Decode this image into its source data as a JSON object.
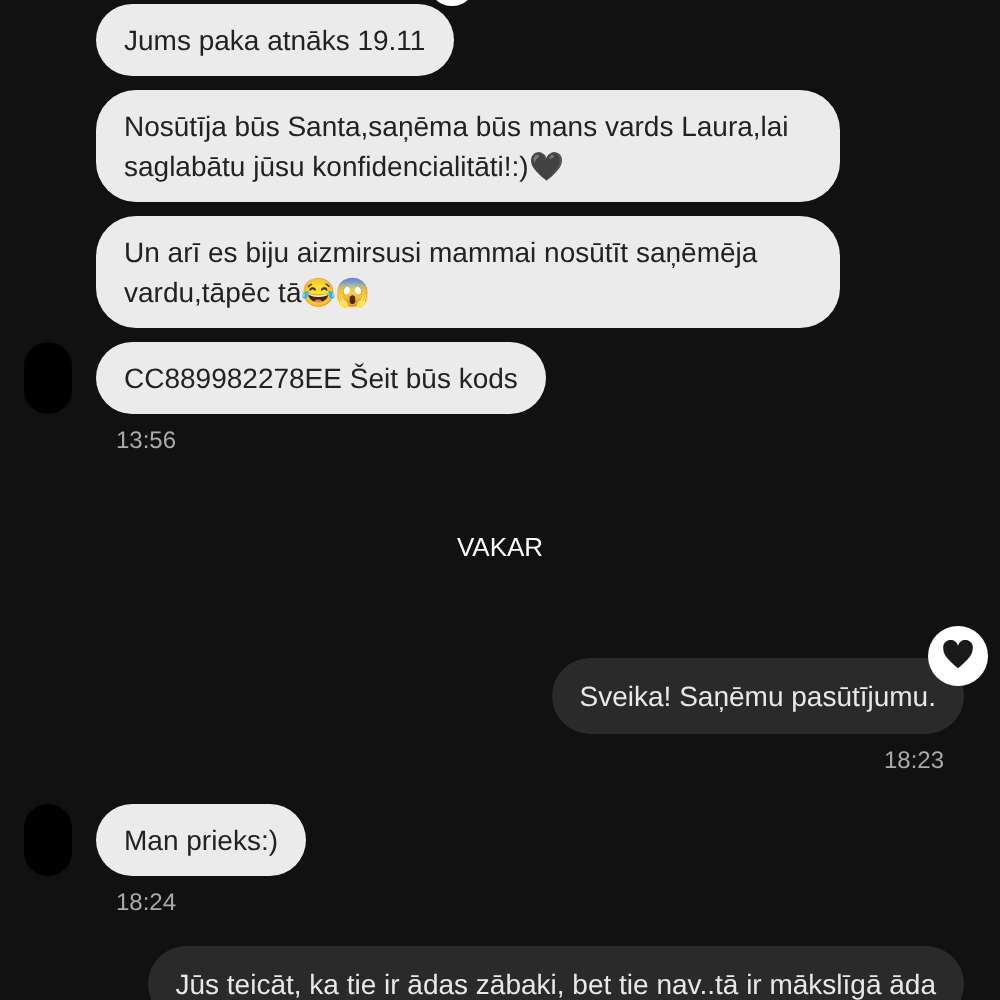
{
  "messages": [
    {
      "kind": "incoming",
      "text": "Jums paka atnāks 19.11",
      "avatar": false,
      "reaction": true
    },
    {
      "kind": "incoming",
      "text": "Nosūtīja būs Santa,saņēma būs mans vards Laura,lai saglabātu jūsu konfidencialitāti!:)🖤",
      "avatar": false,
      "reaction": false
    },
    {
      "kind": "incoming",
      "text": "Un arī es biju aizmirsusi mammai nosūtīt saņēmēja vardu,tāpēc tā😂😱",
      "avatar": false,
      "reaction": false
    },
    {
      "kind": "incoming",
      "text": "CC889982278EE Šeit būs kods",
      "avatar": true,
      "reaction": false,
      "time": "13:56"
    },
    {
      "kind": "date",
      "text": "VAKAR"
    },
    {
      "kind": "outgoing",
      "text": "Sveika! Saņēmu pasūtījumu.",
      "reaction": true,
      "time": "18:23"
    },
    {
      "kind": "incoming",
      "text": "Man prieks:)",
      "avatar": true,
      "reaction": false,
      "time": "18:24"
    },
    {
      "kind": "outgoing",
      "text": "Jūs teicāt, ka tie ir ādas zābaki, bet tie nav..tā ir mākslīgā āda",
      "reaction": false
    }
  ]
}
